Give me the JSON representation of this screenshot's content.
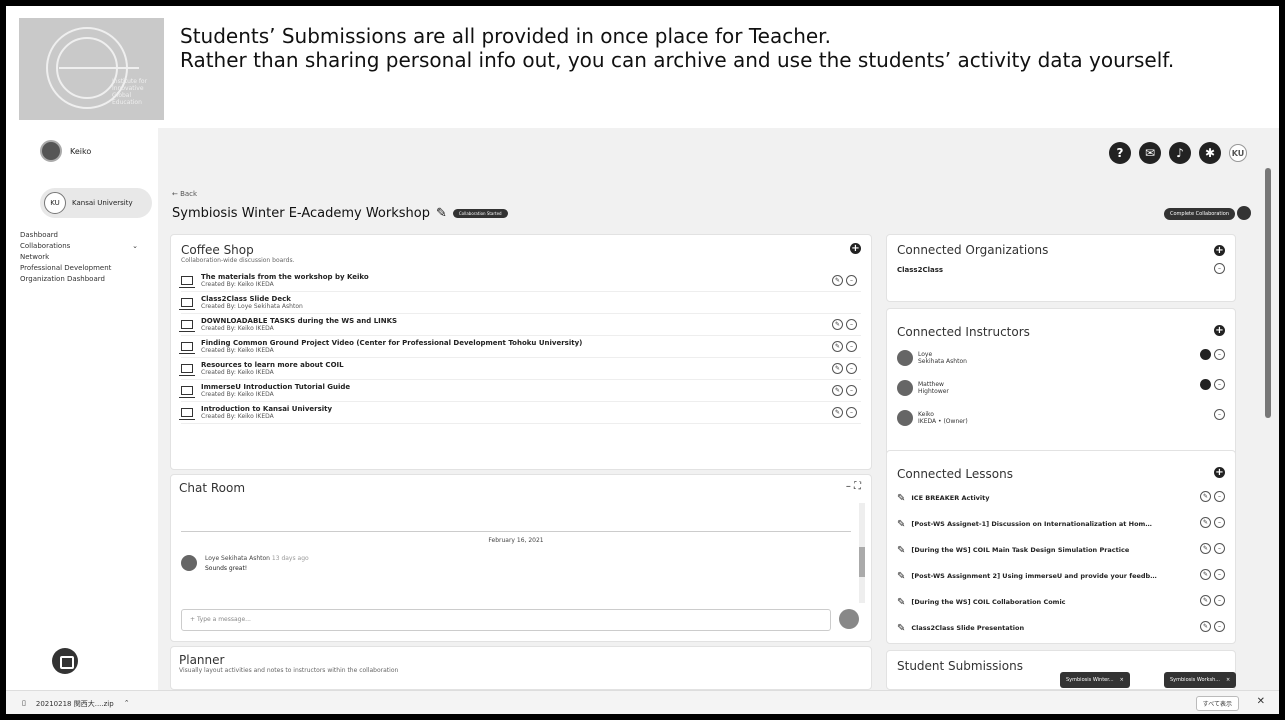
{
  "banner": {
    "institute": "Institute for\nInnovative\nGlobal\nEducation",
    "headline_1": "Students’ Submissions are all provided in once place for Teacher.",
    "headline_2": "Rather than sharing personal info out, you can archive and use the students’ activity data yourself."
  },
  "sidebar": {
    "user": "Keiko",
    "university": "Kansai University",
    "nav": [
      "Dashboard",
      "Collaborations",
      "Network",
      "Professional Development",
      "Organization Dashboard"
    ]
  },
  "header": {
    "back": "← Back",
    "title": "Symbiosis Winter E-Academy Workshop",
    "status_badge": "Collaboration Started",
    "complete_button": "Complete Collaboration"
  },
  "coffee_shop": {
    "title": "Coffee Shop",
    "subtitle": "Collaboration-wide discussion boards.",
    "boards": [
      {
        "title": "The materials from the workshop by Keiko",
        "by": "Created By: Keiko IKEDA"
      },
      {
        "title": "Class2Class Slide Deck",
        "by": "Created By: Loye Sekihata Ashton"
      },
      {
        "title": "DOWNLOADABLE TASKS during the WS and LINKS",
        "by": "Created By: Keiko IKEDA"
      },
      {
        "title": "Finding Common Ground Project Video (Center for Professional Development Tohoku University)",
        "by": "Created By: Keiko IKEDA"
      },
      {
        "title": "Resources to learn more about COIL",
        "by": "Created By: Keiko IKEDA"
      },
      {
        "title": "ImmerseU Introduction Tutorial Guide",
        "by": "Created By: Keiko IKEDA"
      },
      {
        "title": "Introduction to Kansai University",
        "by": "Created By: Keiko IKEDA"
      }
    ]
  },
  "chat": {
    "title": "Chat Room",
    "date": "February 16, 2021",
    "author": "Loye Sekihata Ashton",
    "time": "13 days ago",
    "message": "Sounds great!",
    "placeholder": "Type a message..."
  },
  "planner": {
    "title": "Planner",
    "subtitle": "Visually layout activities and notes to instructors within the collaboration"
  },
  "organizations": {
    "title": "Connected Organizations",
    "items": [
      "Class2Class"
    ]
  },
  "instructors": {
    "title": "Connected Instructors",
    "items": [
      {
        "first": "Loye",
        "last": "Sekihata Ashton"
      },
      {
        "first": "Matthew",
        "last": "Hightower"
      },
      {
        "first": "Keiko",
        "last": "IKEDA • (Owner)"
      }
    ]
  },
  "lessons": {
    "title": "Connected Lessons",
    "items": [
      "ICE BREAKER Activity",
      "[Post-WS Assignet-1] Discussion on Internationalization at Hom…",
      "[During the WS] COIL Main Task Design Simulation Practice",
      "[Post-WS Assignment 2] Using immerseU and provide your feedb…",
      "[During the WS] COIL Collaboration Comic",
      "Class2Class Slide Presentation"
    ]
  },
  "submissions": {
    "title": "Student Submissions",
    "chips": [
      "Symbiosis Winter...",
      "Symbiosis Worksh..."
    ]
  },
  "download_bar": {
    "file": "20210218 関西大....zip",
    "show_all": "すべて表示"
  }
}
